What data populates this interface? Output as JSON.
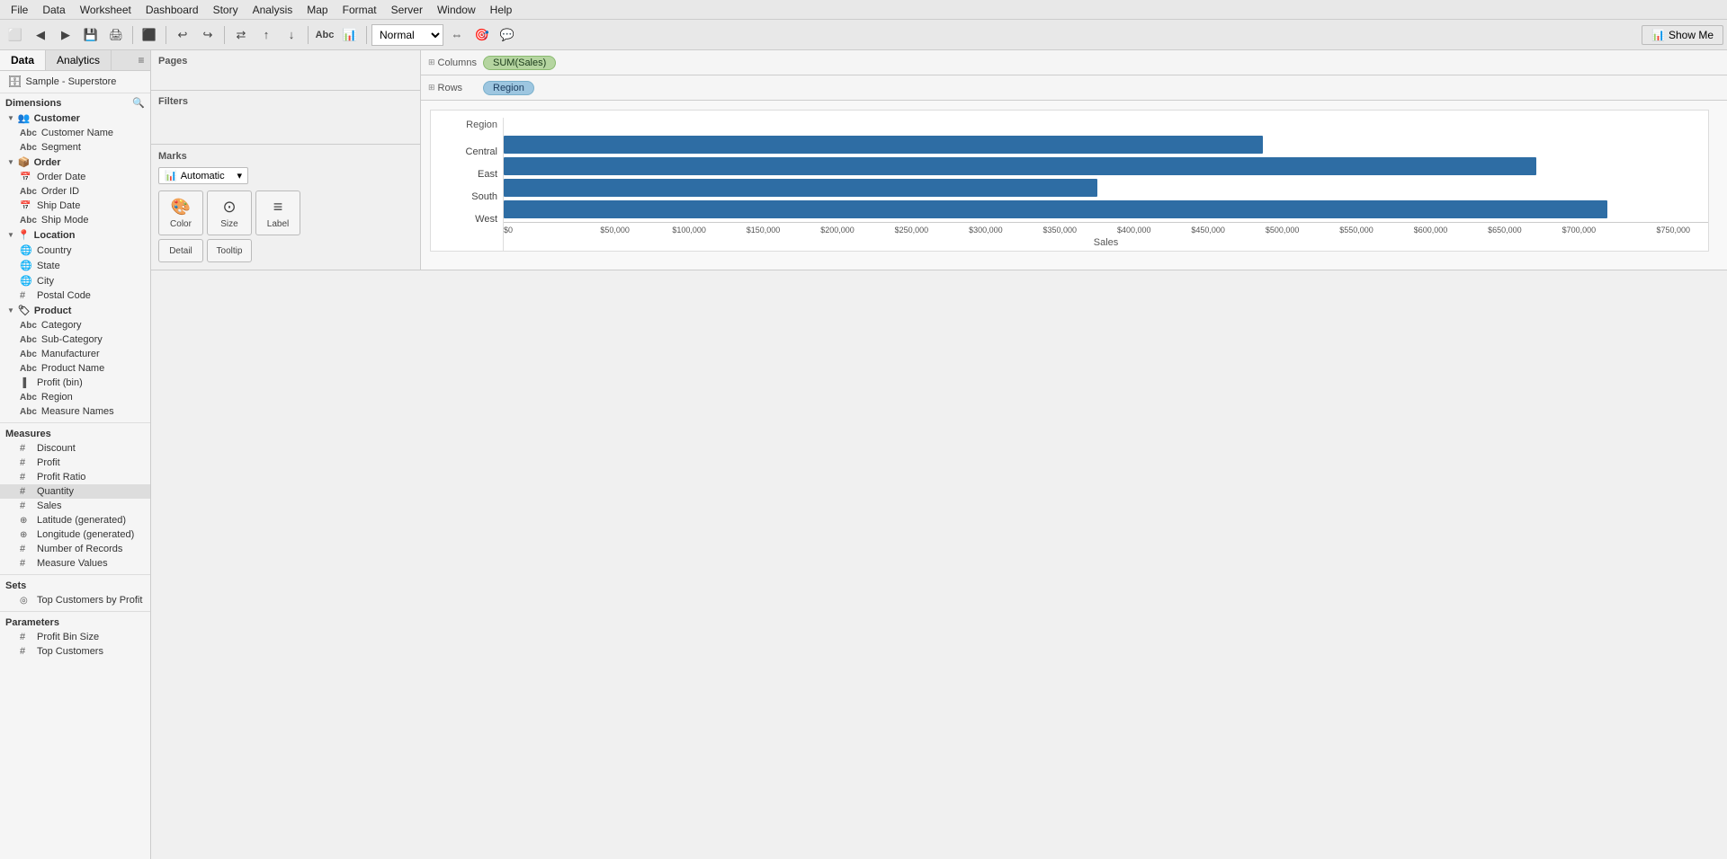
{
  "menubar": {
    "items": [
      "File",
      "Data",
      "Worksheet",
      "Dashboard",
      "Story",
      "Analysis",
      "Map",
      "Format",
      "Server",
      "Window",
      "Help"
    ]
  },
  "toolbar": {
    "show_me_label": "Show Me"
  },
  "panel": {
    "tab_data": "Data",
    "tab_analytics": "Analytics",
    "datasource": "Sample - Superstore"
  },
  "dimensions_label": "Dimensions",
  "measures_label": "Measures",
  "sets_label": "Sets",
  "parameters_label": "Parameters",
  "groups": {
    "customer": {
      "name": "Customer",
      "fields": [
        "Customer Name",
        "Segment"
      ]
    },
    "order": {
      "name": "Order",
      "fields_cal": [
        "Order Date",
        "Ship Date"
      ],
      "fields_abc": [
        "Order ID",
        "Ship Mode"
      ]
    },
    "location": {
      "name": "Location",
      "fields": [
        "Country",
        "State",
        "City",
        "Postal Code"
      ]
    },
    "product": {
      "name": "Product",
      "fields_abc": [
        "Category",
        "Sub-Category",
        "Manufacturer",
        "Product Name"
      ],
      "fields_other": []
    }
  },
  "standalone_dims": [
    {
      "name": "Profit (bin)",
      "type": "bar"
    },
    {
      "name": "Region",
      "type": "abc"
    },
    {
      "name": "Measure Names",
      "type": "abc"
    }
  ],
  "measures": [
    {
      "name": "Discount",
      "type": "#"
    },
    {
      "name": "Profit",
      "type": "#"
    },
    {
      "name": "Profit Ratio",
      "type": "#"
    },
    {
      "name": "Quantity",
      "type": "#",
      "hovered": true
    },
    {
      "name": "Sales",
      "type": "#"
    },
    {
      "name": "Latitude (generated)",
      "type": "globe"
    },
    {
      "name": "Longitude (generated)",
      "type": "globe"
    },
    {
      "name": "Number of Records",
      "type": "#"
    },
    {
      "name": "Measure Values",
      "type": "#"
    }
  ],
  "sets": [
    {
      "name": "Top Customers by Profit",
      "type": "circle"
    }
  ],
  "parameters": [
    {
      "name": "Profit Bin Size",
      "type": "#"
    },
    {
      "name": "Top Customers",
      "type": "#"
    }
  ],
  "shelves": {
    "pages_label": "Pages",
    "filters_label": "Filters",
    "marks_label": "Marks",
    "columns_label": "Columns",
    "rows_label": "Rows",
    "columns_pill": "SUM(Sales)",
    "rows_pill": "Region",
    "marks_type": "Automatic"
  },
  "marks_buttons": [
    {
      "label": "Color",
      "icon": "🎨"
    },
    {
      "label": "Size",
      "icon": "⊙"
    },
    {
      "label": "Label",
      "icon": "≡"
    }
  ],
  "marks_buttons2": [
    {
      "label": "Detail",
      "icon": ""
    },
    {
      "label": "Tooltip",
      "icon": ""
    }
  ],
  "chart": {
    "region_label": "Region",
    "bars": [
      {
        "label": "Central",
        "value": 501240,
        "pct": 64
      },
      {
        "label": "East",
        "value": 678781,
        "pct": 87
      },
      {
        "label": "South",
        "value": 391722,
        "pct": 50
      },
      {
        "label": "West",
        "value": 725458,
        "pct": 93
      }
    ],
    "x_ticks": [
      "$0",
      "$50,000",
      "$100,000",
      "$150,000",
      "$200,000",
      "$250,000",
      "$300,000",
      "$350,000",
      "$400,000",
      "$450,000",
      "$500,000",
      "$550,000",
      "$600,000",
      "$650,000",
      "$700,000",
      "$750,000"
    ],
    "x_axis_label": "Sales"
  }
}
